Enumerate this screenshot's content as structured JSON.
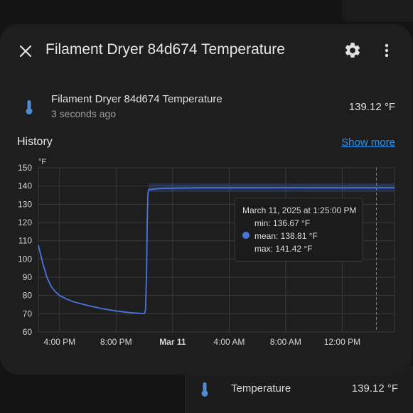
{
  "background_card": {
    "label": "Temperature",
    "value": "139.12 °F",
    "icon": "thermometer-icon"
  },
  "dialog": {
    "title": "Filament Dryer 84d674 Temperature",
    "close_icon": "close-icon",
    "settings_icon": "gear-icon",
    "menu_icon": "more-vert-icon"
  },
  "entity": {
    "name": "Filament Dryer 84d674 Temperature",
    "last_changed": "3 seconds ago",
    "value": "139.12 °F",
    "icon": "thermometer-icon"
  },
  "history": {
    "label": "History",
    "show_more": "Show more"
  },
  "tooltip": {
    "date": "March 11, 2025 at 1:25:00 PM",
    "min": "min: 136.67 °F",
    "mean": "mean: 138.81 °F",
    "max": "max: 141.42 °F"
  },
  "colors": {
    "accent": "#2196f3",
    "series": "#4a74e0"
  },
  "chart_data": {
    "type": "line",
    "ylabel": "°F",
    "ylim": [
      60,
      150
    ],
    "yticks": [
      60,
      70,
      80,
      90,
      100,
      110,
      120,
      130,
      140,
      150
    ],
    "xtick_labels": [
      {
        "label": "4:00 PM",
        "h": 16
      },
      {
        "label": "8:00 PM",
        "h": 20
      },
      {
        "label": "Mar 11",
        "h": 24,
        "bold": true
      },
      {
        "label": "4:00 AM",
        "h": 28
      },
      {
        "label": "8:00 AM",
        "h": 32
      },
      {
        "label": "12:00 PM",
        "h": 36
      }
    ],
    "xlim_hours": [
      14.5,
      39.7
    ],
    "grid": true,
    "cursor_hour": 38.42,
    "series": [
      {
        "points": [
          [
            14.5,
            107.5
          ],
          [
            14.8,
            98
          ],
          [
            15.1,
            90
          ],
          [
            15.4,
            85
          ],
          [
            15.7,
            82
          ],
          [
            16.0,
            80
          ],
          [
            16.5,
            78
          ],
          [
            17.0,
            76.5
          ],
          [
            18.0,
            74.5
          ],
          [
            19.0,
            72.8
          ],
          [
            20.0,
            71.5
          ],
          [
            21.0,
            70.6
          ],
          [
            21.7,
            70.2
          ],
          [
            22.0,
            70.1
          ],
          [
            22.08,
            72
          ],
          [
            22.15,
            90
          ],
          [
            22.2,
            120
          ],
          [
            22.25,
            136
          ],
          [
            22.3,
            138
          ],
          [
            23.0,
            138.6
          ],
          [
            24.0,
            138.8
          ],
          [
            26.0,
            139
          ],
          [
            28.0,
            139
          ],
          [
            30.0,
            139
          ],
          [
            32.0,
            139.1
          ],
          [
            34.0,
            139
          ],
          [
            36.0,
            139
          ],
          [
            38.0,
            139
          ],
          [
            39.7,
            139.1
          ]
        ],
        "band": [
          136.7,
          141.4
        ]
      }
    ]
  }
}
